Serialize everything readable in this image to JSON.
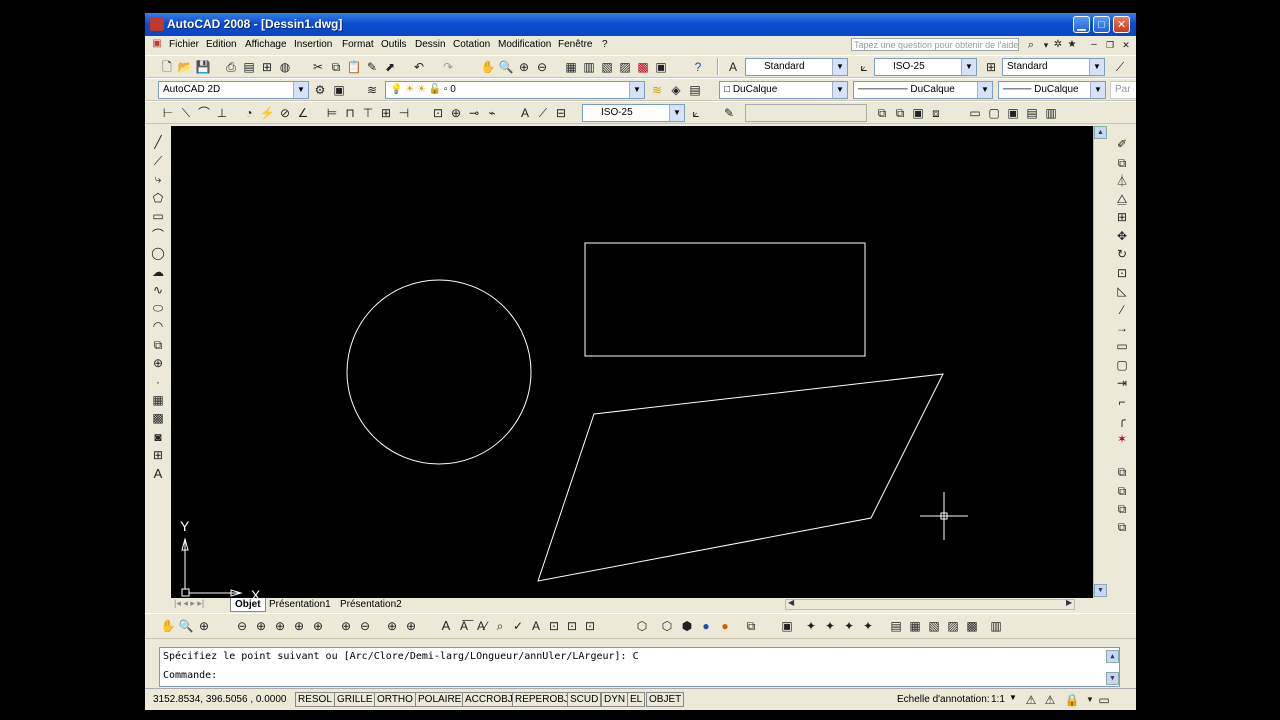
{
  "window": {
    "title": "AutoCAD 2008 - [Dessin1.dwg]"
  },
  "menu": {
    "items": [
      "Fichier",
      "Edition",
      "Affichage",
      "Insertion",
      "Format",
      "Outils",
      "Dessin",
      "Cotation",
      "Modification",
      "Fenêtre",
      "?"
    ],
    "help_placeholder": "Tapez une question pour obtenir de l'aide"
  },
  "toolbar_styles": {
    "text_style": "Standard",
    "dim_style": "ISO-25",
    "table_style": "Standard"
  },
  "toolbar_layers": {
    "workspace": "AutoCAD 2D",
    "layer": "0",
    "color": "DuCalque",
    "linetype": "DuCalque",
    "lineweight": "DuCalque",
    "plot_style": "Par"
  },
  "toolbar_dim": {
    "dim_style": "ISO-25"
  },
  "tabs": [
    "Objet",
    "Présentation1",
    "Présentation2"
  ],
  "ucs": {
    "x_label": "X",
    "y_label": "Y"
  },
  "command": {
    "history": "Spécifiez le point suivant ou [Arc/Clore/Demi-larg/LOngueur/annUler/LArgeur]: C",
    "prompt": "Commande:"
  },
  "status": {
    "coords": "3152.8534, 396.5056 , 0.0000",
    "toggles": [
      "RESOL",
      "GRILLE",
      "ORTHO",
      "POLAIRE",
      "ACCROBJ",
      "REPEROBJ",
      "SCUD",
      "DYN",
      "EL",
      "OBJET"
    ],
    "annotation_label": "Echelle d'annotation:",
    "annotation_scale": "1:1"
  },
  "drawing": {
    "line_color": "#ffffff",
    "background": "#000000"
  },
  "colors": {
    "titlebar": "#0a4ed0",
    "chrome": "#ece9d8"
  }
}
